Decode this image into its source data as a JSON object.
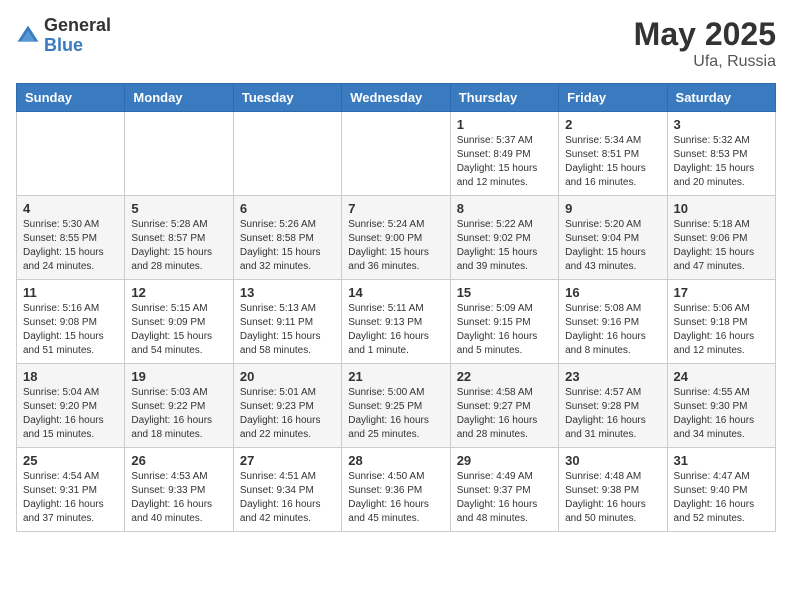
{
  "header": {
    "logo_general": "General",
    "logo_blue": "Blue",
    "month_year": "May 2025",
    "location": "Ufa, Russia"
  },
  "weekdays": [
    "Sunday",
    "Monday",
    "Tuesday",
    "Wednesday",
    "Thursday",
    "Friday",
    "Saturday"
  ],
  "weeks": [
    [
      {
        "day": "",
        "info": ""
      },
      {
        "day": "",
        "info": ""
      },
      {
        "day": "",
        "info": ""
      },
      {
        "day": "",
        "info": ""
      },
      {
        "day": "1",
        "info": "Sunrise: 5:37 AM\nSunset: 8:49 PM\nDaylight: 15 hours\nand 12 minutes."
      },
      {
        "day": "2",
        "info": "Sunrise: 5:34 AM\nSunset: 8:51 PM\nDaylight: 15 hours\nand 16 minutes."
      },
      {
        "day": "3",
        "info": "Sunrise: 5:32 AM\nSunset: 8:53 PM\nDaylight: 15 hours\nand 20 minutes."
      }
    ],
    [
      {
        "day": "4",
        "info": "Sunrise: 5:30 AM\nSunset: 8:55 PM\nDaylight: 15 hours\nand 24 minutes."
      },
      {
        "day": "5",
        "info": "Sunrise: 5:28 AM\nSunset: 8:57 PM\nDaylight: 15 hours\nand 28 minutes."
      },
      {
        "day": "6",
        "info": "Sunrise: 5:26 AM\nSunset: 8:58 PM\nDaylight: 15 hours\nand 32 minutes."
      },
      {
        "day": "7",
        "info": "Sunrise: 5:24 AM\nSunset: 9:00 PM\nDaylight: 15 hours\nand 36 minutes."
      },
      {
        "day": "8",
        "info": "Sunrise: 5:22 AM\nSunset: 9:02 PM\nDaylight: 15 hours\nand 39 minutes."
      },
      {
        "day": "9",
        "info": "Sunrise: 5:20 AM\nSunset: 9:04 PM\nDaylight: 15 hours\nand 43 minutes."
      },
      {
        "day": "10",
        "info": "Sunrise: 5:18 AM\nSunset: 9:06 PM\nDaylight: 15 hours\nand 47 minutes."
      }
    ],
    [
      {
        "day": "11",
        "info": "Sunrise: 5:16 AM\nSunset: 9:08 PM\nDaylight: 15 hours\nand 51 minutes."
      },
      {
        "day": "12",
        "info": "Sunrise: 5:15 AM\nSunset: 9:09 PM\nDaylight: 15 hours\nand 54 minutes."
      },
      {
        "day": "13",
        "info": "Sunrise: 5:13 AM\nSunset: 9:11 PM\nDaylight: 15 hours\nand 58 minutes."
      },
      {
        "day": "14",
        "info": "Sunrise: 5:11 AM\nSunset: 9:13 PM\nDaylight: 16 hours\nand 1 minute."
      },
      {
        "day": "15",
        "info": "Sunrise: 5:09 AM\nSunset: 9:15 PM\nDaylight: 16 hours\nand 5 minutes."
      },
      {
        "day": "16",
        "info": "Sunrise: 5:08 AM\nSunset: 9:16 PM\nDaylight: 16 hours\nand 8 minutes."
      },
      {
        "day": "17",
        "info": "Sunrise: 5:06 AM\nSunset: 9:18 PM\nDaylight: 16 hours\nand 12 minutes."
      }
    ],
    [
      {
        "day": "18",
        "info": "Sunrise: 5:04 AM\nSunset: 9:20 PM\nDaylight: 16 hours\nand 15 minutes."
      },
      {
        "day": "19",
        "info": "Sunrise: 5:03 AM\nSunset: 9:22 PM\nDaylight: 16 hours\nand 18 minutes."
      },
      {
        "day": "20",
        "info": "Sunrise: 5:01 AM\nSunset: 9:23 PM\nDaylight: 16 hours\nand 22 minutes."
      },
      {
        "day": "21",
        "info": "Sunrise: 5:00 AM\nSunset: 9:25 PM\nDaylight: 16 hours\nand 25 minutes."
      },
      {
        "day": "22",
        "info": "Sunrise: 4:58 AM\nSunset: 9:27 PM\nDaylight: 16 hours\nand 28 minutes."
      },
      {
        "day": "23",
        "info": "Sunrise: 4:57 AM\nSunset: 9:28 PM\nDaylight: 16 hours\nand 31 minutes."
      },
      {
        "day": "24",
        "info": "Sunrise: 4:55 AM\nSunset: 9:30 PM\nDaylight: 16 hours\nand 34 minutes."
      }
    ],
    [
      {
        "day": "25",
        "info": "Sunrise: 4:54 AM\nSunset: 9:31 PM\nDaylight: 16 hours\nand 37 minutes."
      },
      {
        "day": "26",
        "info": "Sunrise: 4:53 AM\nSunset: 9:33 PM\nDaylight: 16 hours\nand 40 minutes."
      },
      {
        "day": "27",
        "info": "Sunrise: 4:51 AM\nSunset: 9:34 PM\nDaylight: 16 hours\nand 42 minutes."
      },
      {
        "day": "28",
        "info": "Sunrise: 4:50 AM\nSunset: 9:36 PM\nDaylight: 16 hours\nand 45 minutes."
      },
      {
        "day": "29",
        "info": "Sunrise: 4:49 AM\nSunset: 9:37 PM\nDaylight: 16 hours\nand 48 minutes."
      },
      {
        "day": "30",
        "info": "Sunrise: 4:48 AM\nSunset: 9:38 PM\nDaylight: 16 hours\nand 50 minutes."
      },
      {
        "day": "31",
        "info": "Sunrise: 4:47 AM\nSunset: 9:40 PM\nDaylight: 16 hours\nand 52 minutes."
      }
    ]
  ]
}
